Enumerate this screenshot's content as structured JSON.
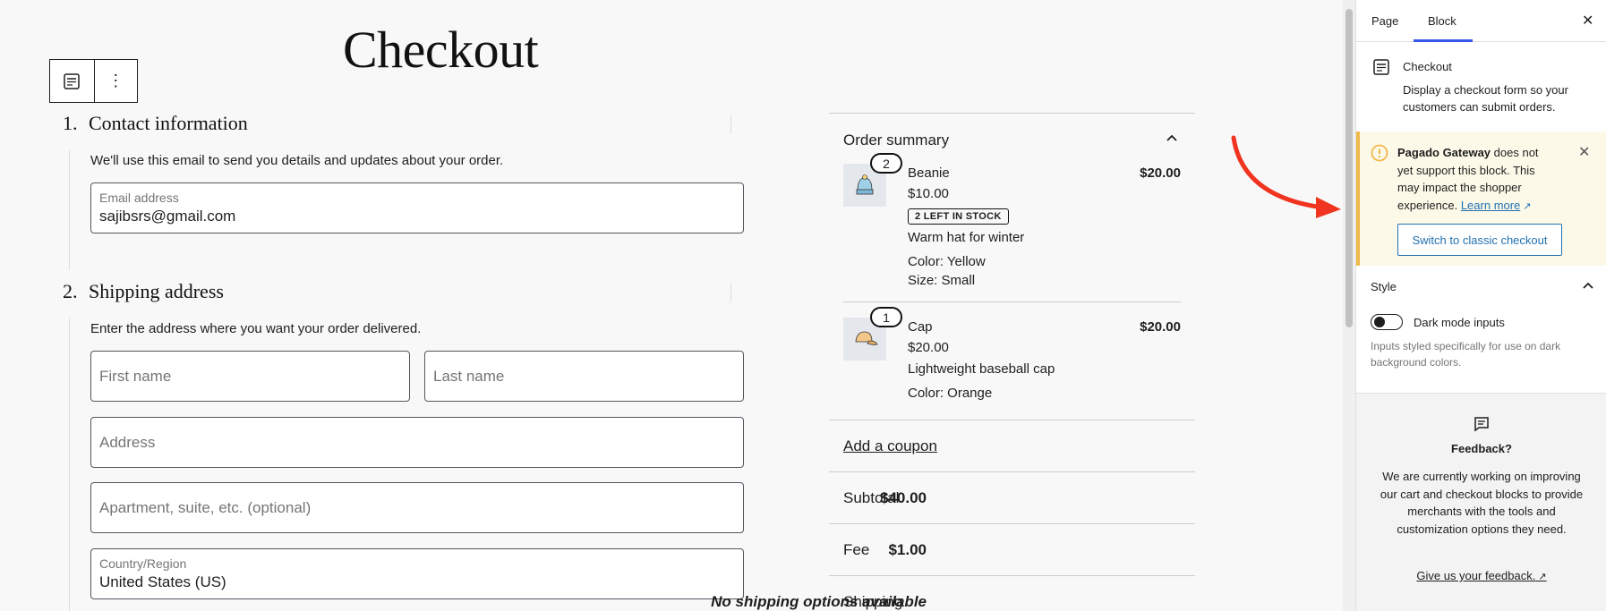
{
  "editor": {
    "page_title": "Checkout",
    "contact": {
      "number": "1.",
      "title": "Contact information",
      "description": "We'll use this email to send you details and updates about your order.",
      "email_label": "Email address",
      "email_value": "sajibsrs@gmail.com"
    },
    "shipping": {
      "number": "2.",
      "title": "Shipping address",
      "description": "Enter the address where you want your order delivered.",
      "first_name_placeholder": "First name",
      "last_name_placeholder": "Last name",
      "address_placeholder": "Address",
      "apartment_placeholder": "Apartment, suite, etc. (optional)",
      "country_label": "Country/Region",
      "country_value": "United States (US)"
    }
  },
  "order_summary": {
    "title": "Order summary",
    "items": [
      {
        "qty": "2",
        "name": "Beanie",
        "unit_price": "$10.00",
        "total": "$20.00",
        "badge": "2 LEFT IN STOCK",
        "description": "Warm hat for winter",
        "attributes": [
          "Color: Yellow",
          "Size: Small"
        ]
      },
      {
        "qty": "1",
        "name": "Cap",
        "unit_price": "$20.00",
        "total": "$20.00",
        "description": "Lightweight baseball cap",
        "attributes": [
          "Color: Orange"
        ]
      }
    ],
    "coupon": "Add a coupon",
    "subtotal_label": "Subtotal",
    "subtotal_value": "$40.00",
    "fee_label": "Fee",
    "fee_value": "$1.00",
    "shipping_label": "Shipping",
    "shipping_value": "No shipping options available"
  },
  "sidebar": {
    "tabs": [
      "Page",
      "Block"
    ],
    "active_tab": "Block",
    "block_name": "Checkout",
    "block_description": "Display a checkout form so your customers can submit orders.",
    "notice": {
      "gateway": "Pagado Gateway",
      "text": " does not yet support this block. This may impact the shopper experience. ",
      "link": "Learn more",
      "button": "Switch to classic checkout"
    },
    "style": {
      "title": "Style",
      "toggle_label": "Dark mode inputs",
      "toggle_help": "Inputs styled specifically for use on dark background colors."
    },
    "feedback": {
      "title": "Feedback?",
      "text": "We are currently working on improving our cart and checkout blocks to provide merchants with the tools and customization options they need.",
      "link": "Give us your feedback."
    }
  },
  "colors": {
    "accent": "#3858e9",
    "link": "#2271b1",
    "notice_border": "#f0b849",
    "notice_bg": "#fcf9e8",
    "arrow": "#f0341f"
  }
}
